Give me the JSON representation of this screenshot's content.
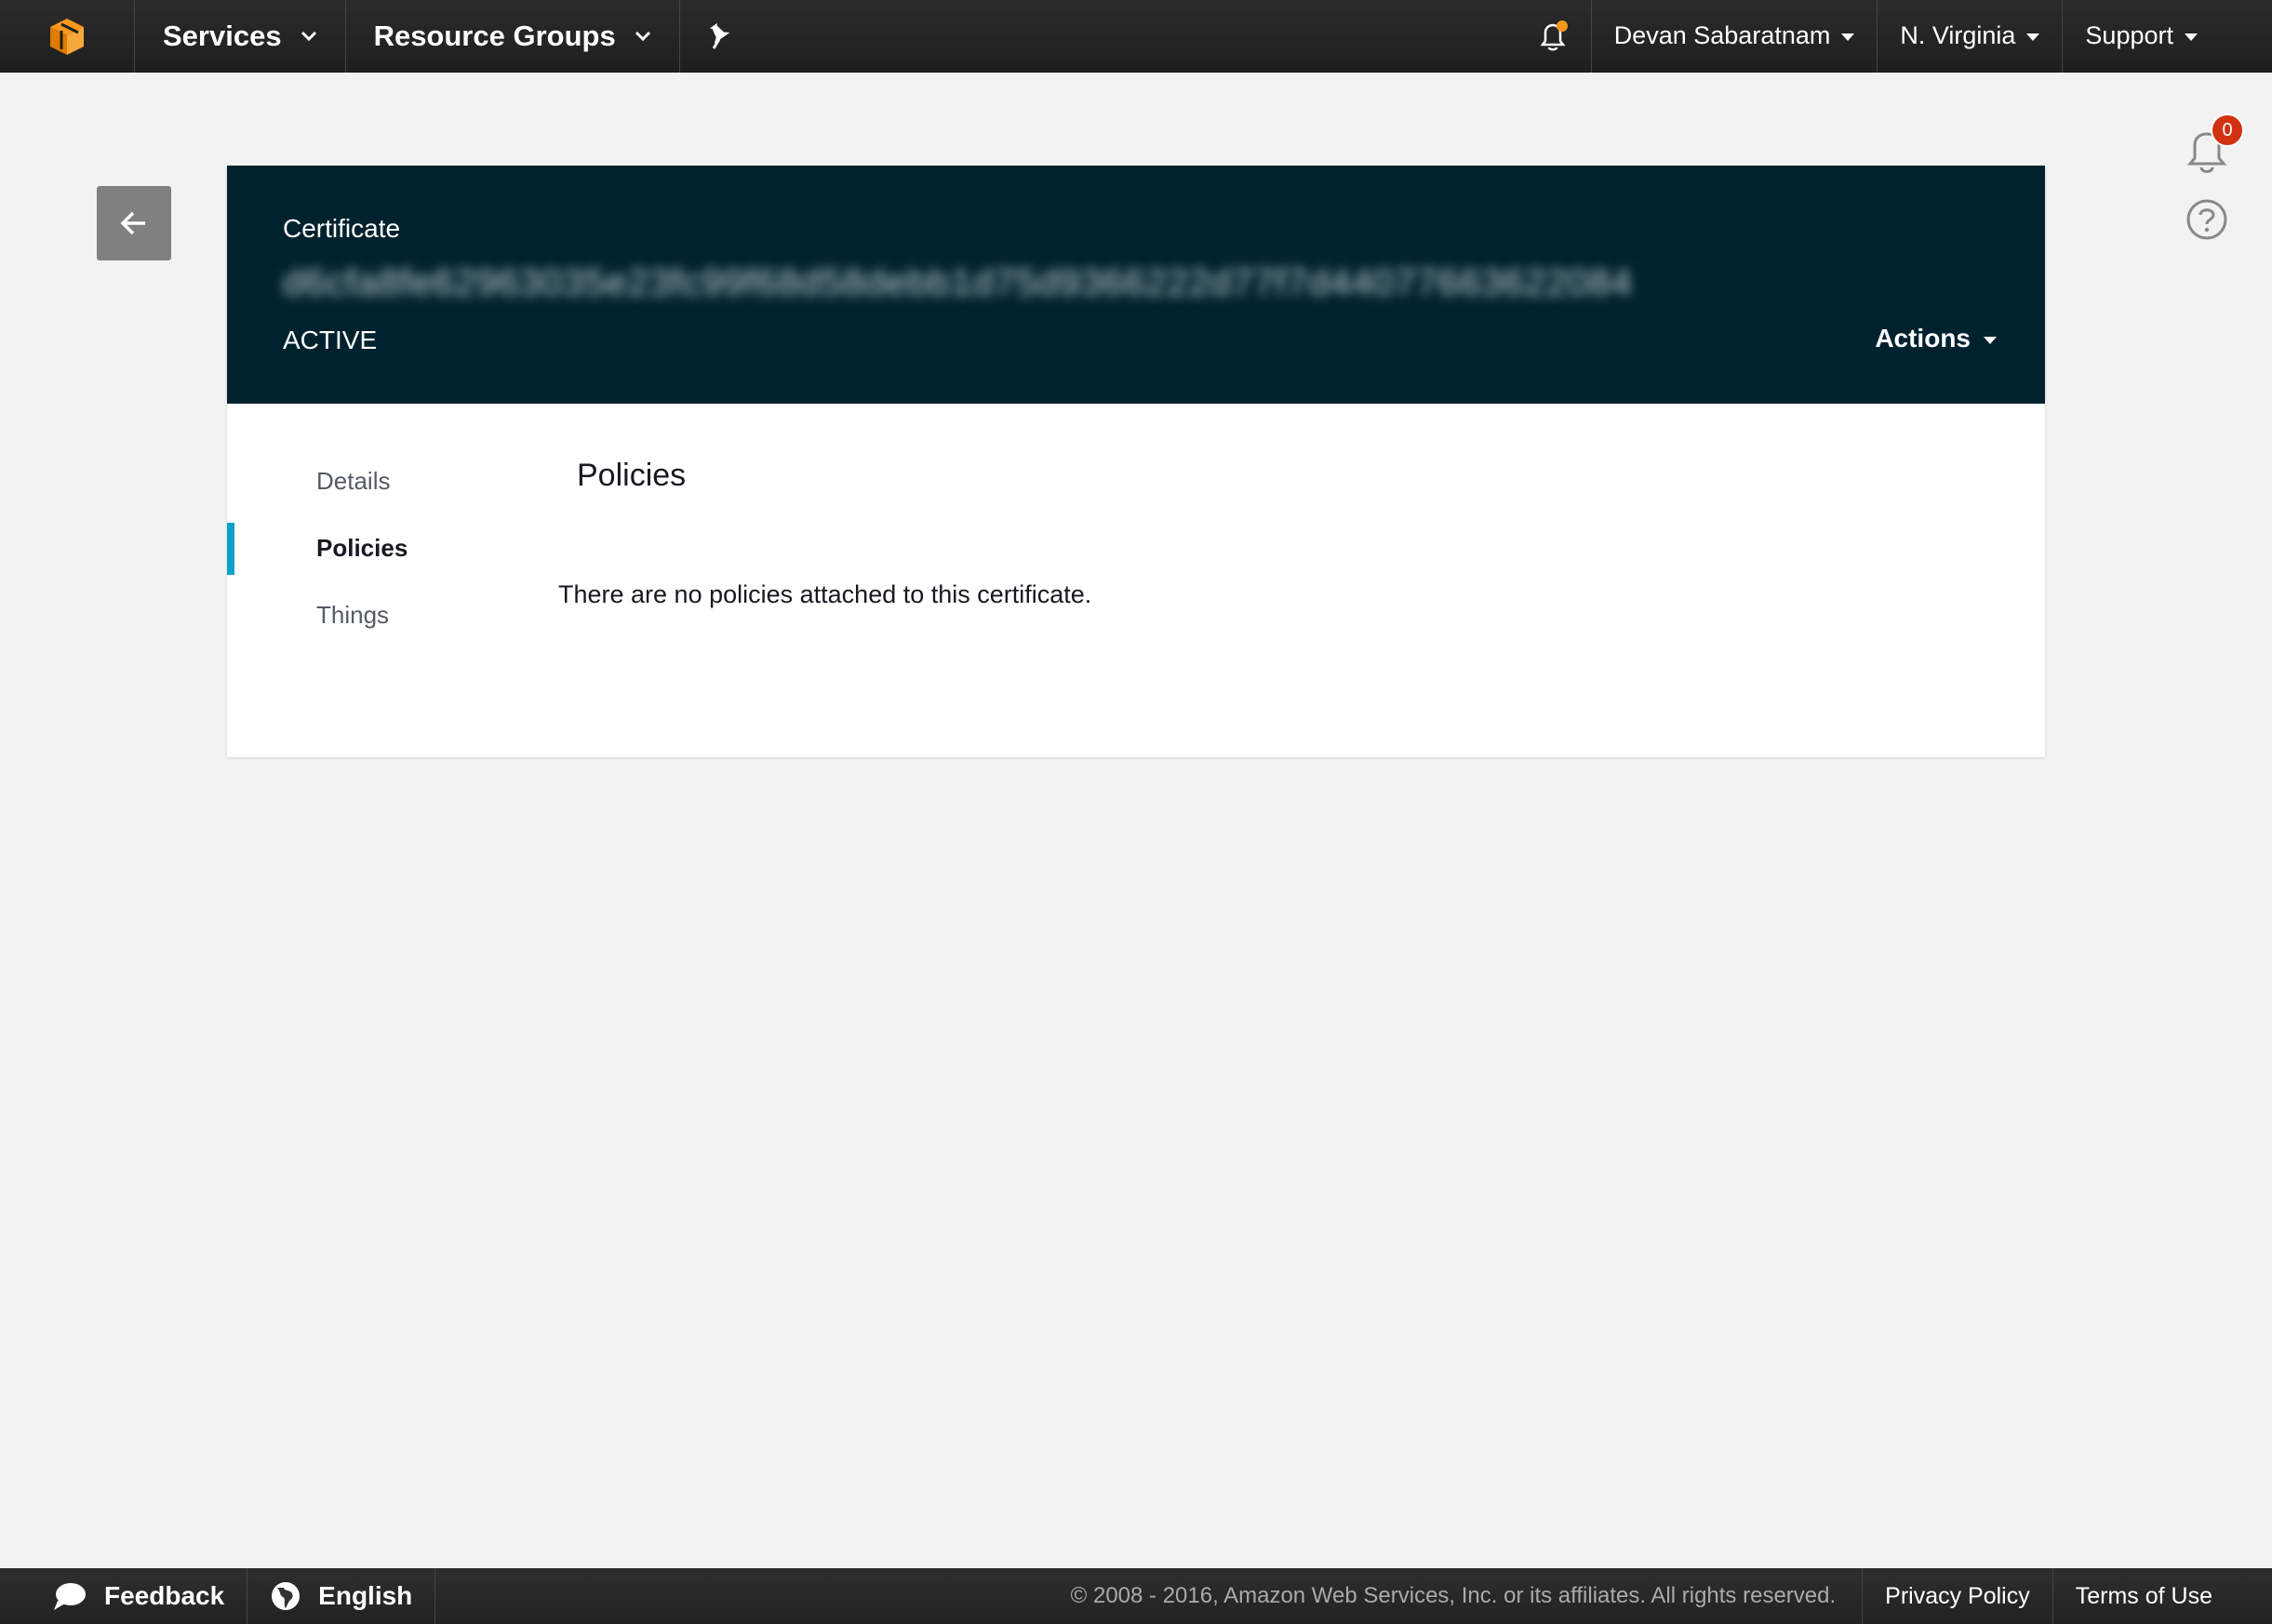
{
  "topnav": {
    "services_label": "Services",
    "resource_groups_label": "Resource Groups",
    "user_label": "Devan Sabaratnam",
    "region_label": "N. Virginia",
    "support_label": "Support"
  },
  "side": {
    "notification_count": "0"
  },
  "certificate": {
    "label": "Certificate",
    "id": "d6cfa8fe62963035e23fc99f68d58debb1d75d9366222d77f7d44077663622084",
    "status": "ACTIVE",
    "actions_label": "Actions"
  },
  "tabs": [
    {
      "label": "Details"
    },
    {
      "label": "Policies"
    },
    {
      "label": "Things"
    }
  ],
  "content": {
    "title": "Policies",
    "empty_message": "There are no policies attached to this certificate."
  },
  "footer": {
    "feedback_label": "Feedback",
    "language_label": "English",
    "copyright": "© 2008 - 2016, Amazon Web Services, Inc. or its affiliates. All rights reserved.",
    "privacy_label": "Privacy Policy",
    "terms_label": "Terms of Use"
  },
  "colors": {
    "nav_bg": "#232323",
    "header_bg": "#00222e",
    "accent": "#0aa1c9",
    "logo_orange": "#f7981d",
    "badge_red": "#d13212"
  }
}
